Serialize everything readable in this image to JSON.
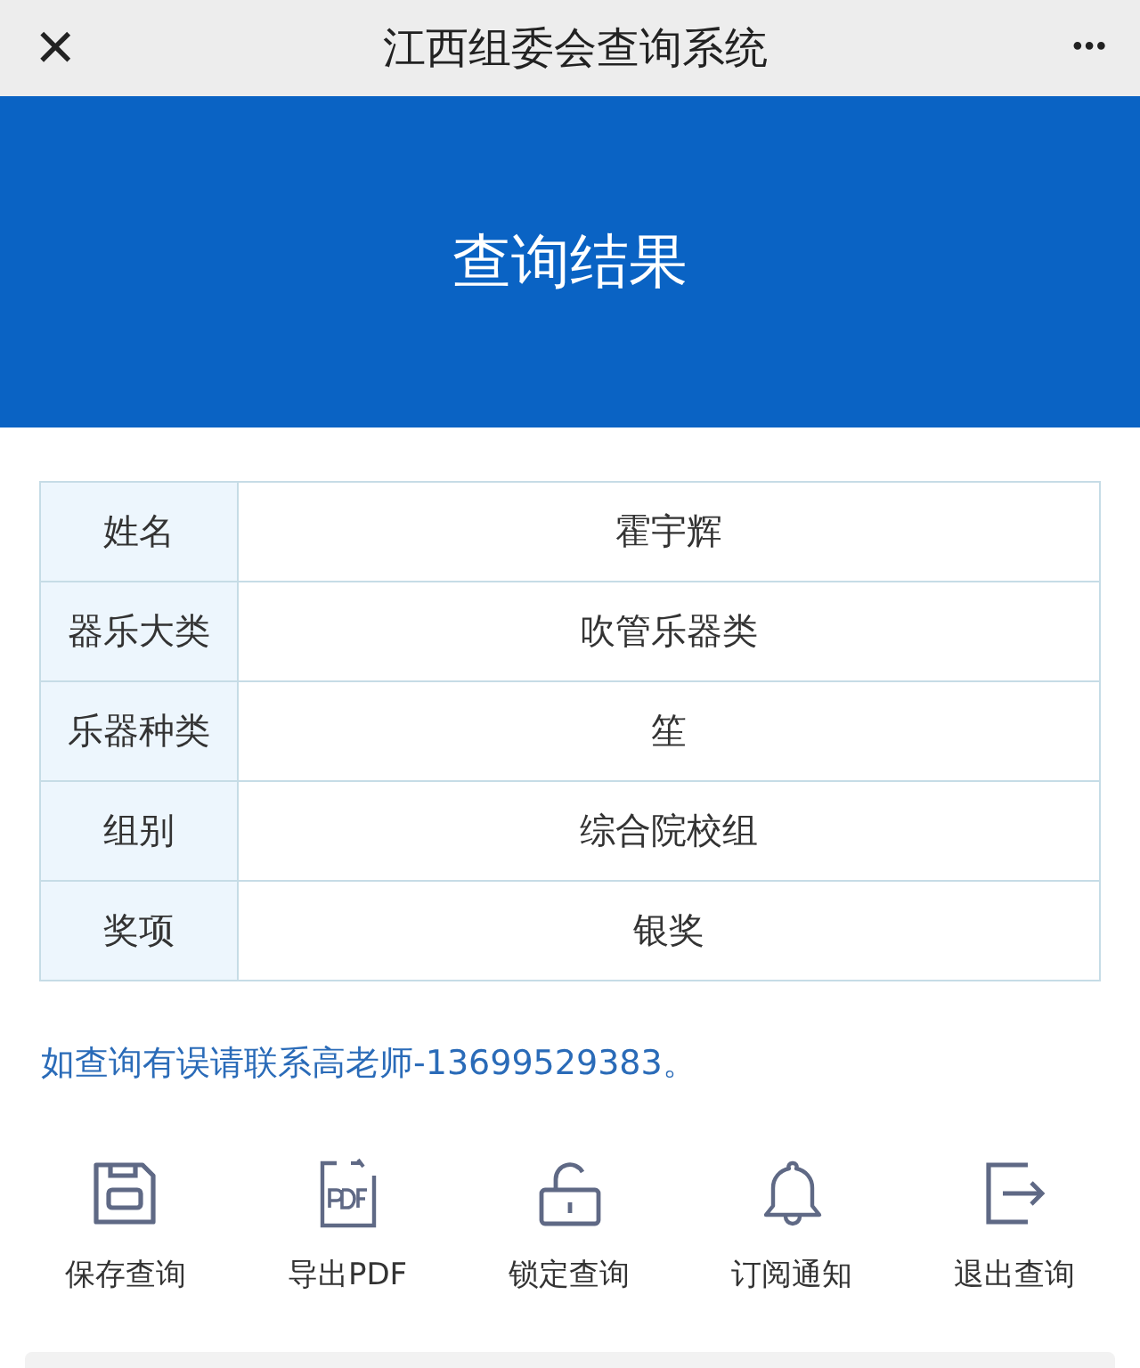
{
  "top_bar": {
    "close": "×",
    "title": "江西组委会查询系统",
    "more": "•••"
  },
  "banner": {
    "title": "查询结果"
  },
  "table": {
    "rows": [
      {
        "label": "姓名",
        "value": "霍宇辉"
      },
      {
        "label": "器乐大类",
        "value": "吹管乐器类"
      },
      {
        "label": "乐器种类",
        "value": "笙"
      },
      {
        "label": "组别",
        "value": "综合院校组"
      },
      {
        "label": "奖项",
        "value": "银奖"
      }
    ]
  },
  "notice": "如查询有误请联系高老师-13699529383。",
  "actions": [
    {
      "kind": "save",
      "label": "保存查询"
    },
    {
      "kind": "pdf",
      "label": "导出PDF"
    },
    {
      "kind": "lock",
      "label": "锁定查询"
    },
    {
      "kind": "bell",
      "label": "订阅通知"
    },
    {
      "kind": "exit",
      "label": "退出查询"
    }
  ]
}
